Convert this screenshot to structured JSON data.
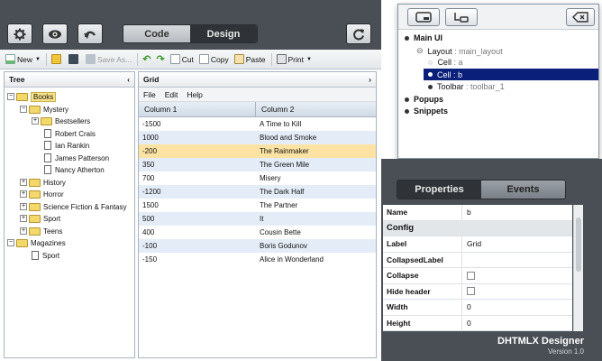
{
  "top": {
    "code_label": "Code",
    "design_label": "Design"
  },
  "toolbar": {
    "new": "New",
    "save_as": "Save As...",
    "cut": "Cut",
    "copy": "Copy",
    "paste": "Paste",
    "print": "Print"
  },
  "tree": {
    "title": "Tree",
    "nodes": {
      "books": "Books",
      "mystery": "Mystery",
      "bestsellers": "Bestsellers",
      "robert_crais": "Robert Crais",
      "ian_rankin": "Ian Rankin",
      "james_patterson": "James Patterson",
      "nancy_atherton": "Nancy Atherton",
      "history": "History",
      "horror": "Horror",
      "scifi": "Science Fiction & Fantasy",
      "sport": "Sport",
      "teens": "Teens",
      "magazines": "Magazines",
      "sport2": "Sport"
    }
  },
  "grid": {
    "title": "Grid",
    "menu": [
      "File",
      "Edit",
      "Help"
    ],
    "columns": [
      "Column 1",
      "Column 2"
    ],
    "rows": [
      [
        "-1500",
        "A Time to Kill"
      ],
      [
        "1000",
        "Blood and Smoke"
      ],
      [
        "-200",
        "The Rainmaker"
      ],
      [
        "350",
        "The Green Mile"
      ],
      [
        "700",
        "Misery"
      ],
      [
        "-1200",
        "The Dark Half"
      ],
      [
        "1500",
        "The Partner"
      ],
      [
        "500",
        "It"
      ],
      [
        "400",
        "Cousin Bette"
      ],
      [
        "-100",
        "Boris Godunov"
      ],
      [
        "-150",
        "Alice in Wonderland"
      ]
    ]
  },
  "designer": {
    "main_ui": "Main UI",
    "layout": "Layout",
    "layout_name": ": main_layout",
    "cell_a": "Cell",
    "cell_a_name": ": a",
    "cell_b": "Cell",
    "cell_b_name": ": b",
    "toolbar": "Toolbar",
    "toolbar_name": ": toolbar_1",
    "popups": "Popups",
    "snippets": "Snippets"
  },
  "properties": {
    "tab_properties": "Properties",
    "tab_events": "Events",
    "rows": {
      "name_k": "Name",
      "name_v": "b",
      "config": "Config",
      "label_k": "Label",
      "label_v": "Grid",
      "collapsed_k": "CollapsedLabel",
      "collapse_k": "Collapse",
      "hide_k": "Hide header",
      "width_k": "Width",
      "width_v": "0",
      "height_k": "Height",
      "height_v": "0"
    }
  },
  "brand": {
    "name": "DHTMLX Designer",
    "version": "Version 1.0"
  },
  "colors": {
    "chrome": "#4a4f55",
    "selection": "#fce3a3",
    "tree_selected": "#f8e38a",
    "designer_selected": "#0a1f7a"
  }
}
